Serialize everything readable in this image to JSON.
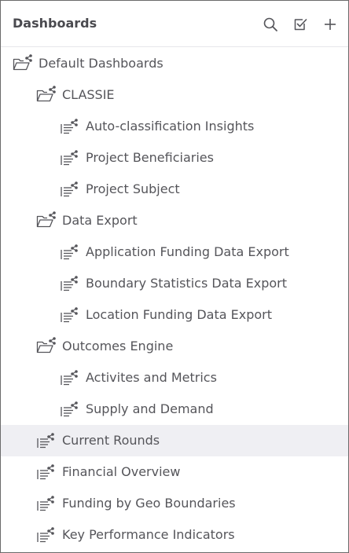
{
  "header": {
    "title": "Dashboards",
    "search_icon": "search-icon",
    "select_icon": "checkbox-select-icon",
    "add_icon": "plus-icon"
  },
  "colors": {
    "text": "#55555a",
    "title": "#4a4a4f",
    "icon": "#55555a",
    "selected_bg": "#efeff3",
    "border": "#6b6b6b"
  },
  "tree": {
    "root": "Default Dashboards",
    "classie": {
      "label": "CLASSIE",
      "items": [
        "Auto-classification Insights",
        "Project Beneficiaries",
        "Project Subject"
      ]
    },
    "data_export": {
      "label": "Data Export",
      "items": [
        "Application Funding Data Export",
        "Boundary Statistics Data Export",
        "Location Funding Data Export"
      ]
    },
    "outcomes_engine": {
      "label": "Outcomes Engine",
      "items": [
        "Activites and Metrics",
        "Supply and Demand"
      ]
    },
    "dashboards": [
      "Current Rounds",
      "Financial Overview",
      "Funding by Geo Boundaries",
      "Key Performance Indicators"
    ],
    "selected": "Current Rounds"
  }
}
